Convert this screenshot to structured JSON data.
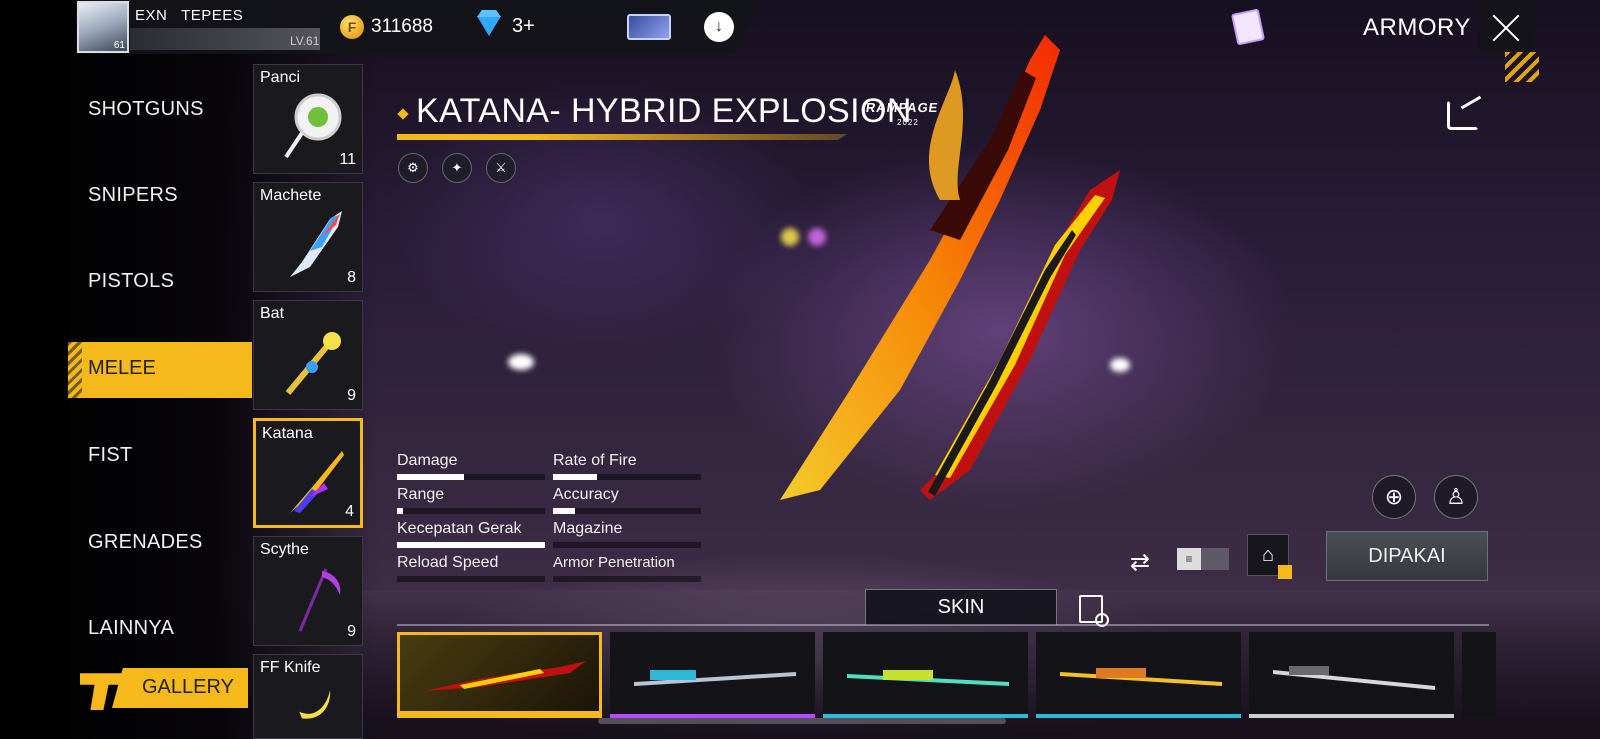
{
  "player": {
    "name": "EXN   TEPEES",
    "avatar_level": "61",
    "level": "LV.61"
  },
  "currency": {
    "coin_symbol": "F",
    "coins": "311688",
    "diamonds": "3+"
  },
  "header": {
    "title": "ARMORY"
  },
  "categories": [
    {
      "label": "SHOTGUNS",
      "active": false
    },
    {
      "label": "SNIPERS",
      "active": false
    },
    {
      "label": "PISTOLS",
      "active": false
    },
    {
      "label": "MELEE",
      "active": true
    },
    {
      "label": "FIST",
      "active": false
    },
    {
      "label": "GRENADES",
      "active": false
    },
    {
      "label": "LAINNYA",
      "active": false
    }
  ],
  "gallery_label": "GALLERY",
  "weapons": [
    {
      "name": "Panci",
      "count": "11"
    },
    {
      "name": "Machete",
      "count": "8"
    },
    {
      "name": "Bat",
      "count": "9"
    },
    {
      "name": "Katana",
      "count": "4",
      "selected": true
    },
    {
      "name": "Scythe",
      "count": "9"
    },
    {
      "name": "FF Knife",
      "count": ""
    }
  ],
  "selected_weapon": {
    "title": "KATANA- HYBRID EXPLOSION",
    "badge": "RAMPAGE",
    "badge_year": "2022"
  },
  "stats": [
    {
      "label": "Damage",
      "value": 0.45
    },
    {
      "label": "Rate of Fire",
      "value": 0.3
    },
    {
      "label": "Range",
      "value": 0.04
    },
    {
      "label": "Accuracy",
      "value": 0.15
    },
    {
      "label": "Kecepatan Gerak",
      "value": 1.0
    },
    {
      "label": "Magazine",
      "value": 0.0
    },
    {
      "label": "Reload Speed",
      "value": 0.0
    },
    {
      "label": "Armor Penetration",
      "value": 0.0
    }
  ],
  "actions": {
    "equip_label": "DIPAKAI",
    "skin_tab": "SKIN"
  },
  "skins": [
    {
      "accent": "#f6b91b",
      "selected": true
    },
    {
      "accent": "#b44cff",
      "selected": false
    },
    {
      "accent": "#2fb8d8",
      "selected": false
    },
    {
      "accent": "#2fb8d8",
      "selected": false
    },
    {
      "accent": "#d0d0d0",
      "selected": false
    }
  ],
  "colors": {
    "accent": "#f6b91b",
    "panel": "#1a1a1e"
  }
}
